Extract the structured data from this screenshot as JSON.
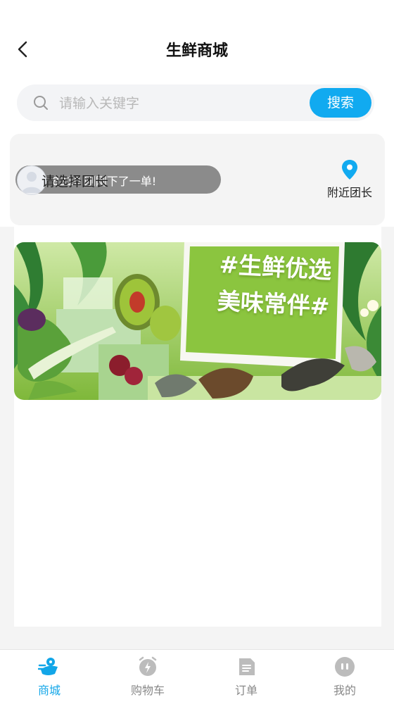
{
  "header": {
    "title": "生鲜商城"
  },
  "search": {
    "placeholder": "请输入关键字",
    "button_label": "搜索"
  },
  "leader": {
    "select_label": "请选择团长",
    "notice_text": "8310 刚刚下了一单!",
    "nearby_label": "附近团长"
  },
  "banner": {
    "line1": "#生鲜优选",
    "line2": "美味常伴#"
  },
  "tabbar": {
    "tabs": [
      {
        "label": "商城",
        "icon": "shop-icon",
        "active": true
      },
      {
        "label": "购物车",
        "icon": "cart-icon",
        "active": false
      },
      {
        "label": "订单",
        "icon": "order-icon",
        "active": false
      },
      {
        "label": "我的",
        "icon": "profile-icon",
        "active": false
      }
    ]
  },
  "colors": {
    "accent": "#11aaf0",
    "inactive": "#b7b7b7",
    "banner_green": "#8bc53f"
  }
}
